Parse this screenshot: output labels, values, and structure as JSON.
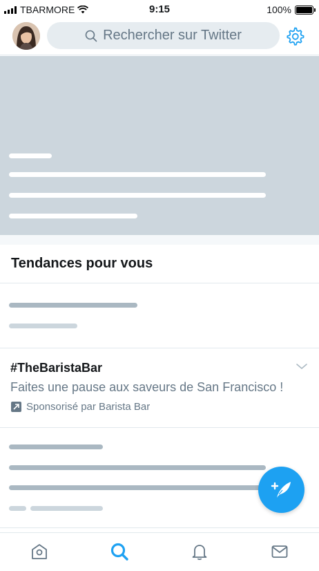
{
  "status_bar": {
    "carrier": "TBARMORE",
    "time": "9:15",
    "battery": "100%"
  },
  "header": {
    "search_placeholder": "Rechercher sur Twitter",
    "avatar_icon": "user-avatar",
    "settings_icon": "gear-icon"
  },
  "trends": {
    "section_title": "Tendances pour vous",
    "promoted": {
      "hashtag": "#TheBaristaBar",
      "description": "Faites une pause aux saveurs de San Francisco !",
      "sponsor": "Sponsorisé par Barista Bar",
      "promoted_icon": "promoted-arrow-icon",
      "menu_icon": "chevron-down-icon"
    }
  },
  "fab": {
    "icon": "compose-tweet-icon"
  },
  "tab_bar": {
    "tabs": [
      {
        "icon": "home-icon",
        "active": false
      },
      {
        "icon": "search-icon",
        "active": true
      },
      {
        "icon": "bell-icon",
        "active": false
      },
      {
        "icon": "mail-icon",
        "active": false
      }
    ]
  },
  "colors": {
    "accent": "#1da1f2",
    "text_primary": "#14171a",
    "text_secondary": "#657786",
    "placeholder_bg": "#ccd6dd",
    "skeleton_dark": "#aab8c2",
    "search_bg": "#e6ecf0"
  }
}
